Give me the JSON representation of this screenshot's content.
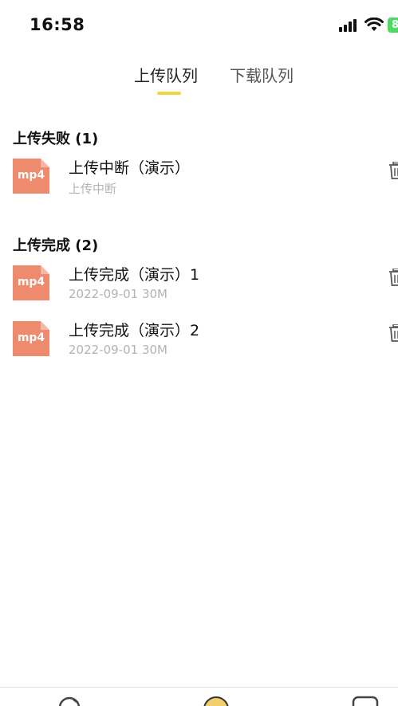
{
  "status_bar": {
    "time": "16:58",
    "battery": "8"
  },
  "tabs": [
    {
      "label": "上传队列",
      "active": true
    },
    {
      "label": "下载队列",
      "active": false
    }
  ],
  "accent_color": "#f5d442",
  "file_icon_color": "#ee8a6e",
  "sections": [
    {
      "title": "上传失败 (1)",
      "items": [
        {
          "name": "上传中断（演示）",
          "meta": "上传中断",
          "type": "mp4"
        }
      ]
    },
    {
      "title": "上传完成 (2)",
      "items": [
        {
          "name": "上传完成（演示）1",
          "meta": "2022-09-01 30M",
          "type": "mp4"
        },
        {
          "name": "上传完成（演示）2",
          "meta": "2022-09-01 30M",
          "type": "mp4"
        }
      ]
    }
  ],
  "icons": {
    "signal": "cellular-signal-icon",
    "wifi": "wifi-icon",
    "battery": "battery-icon",
    "delete": "trash-icon",
    "nav_left": "nav-left-icon",
    "nav_center": "nav-center-icon",
    "nav_right": "nav-right-icon"
  }
}
